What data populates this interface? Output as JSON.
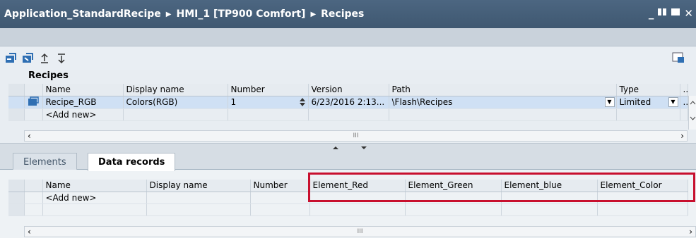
{
  "breadcrumb": {
    "items": [
      "Application_StandardRecipe",
      "HMI_1 [TP900 Comfort]",
      "Recipes"
    ],
    "separator": "▶"
  },
  "window_controls": [
    "_",
    "▪▪",
    "■",
    "✕"
  ],
  "recipes": {
    "title": "Recipes",
    "columns": [
      "Name",
      "Display name",
      "Number",
      "Version",
      "Path",
      "Type",
      ".."
    ],
    "rows": [
      {
        "name": "Recipe_RGB",
        "display_name": "Colors(RGB)",
        "number": "1",
        "version": "6/23/2016 2:13...",
        "path": "\\Flash\\Recipes",
        "type": "Limited"
      }
    ],
    "add_new": "<Add new>",
    "scroll_marker": "III"
  },
  "tabs": [
    "Elements",
    "Data records"
  ],
  "data_records": {
    "columns": [
      "Name",
      "Display name",
      "Number",
      "Element_Red",
      "Element_Green",
      "Element_blue",
      "Element_Color"
    ],
    "add_new": "<Add new>",
    "scroll_marker": "III"
  },
  "colors": {
    "titlebar": "#44607b",
    "highlight": "#c8102e",
    "selection": "#cfe0f4"
  }
}
